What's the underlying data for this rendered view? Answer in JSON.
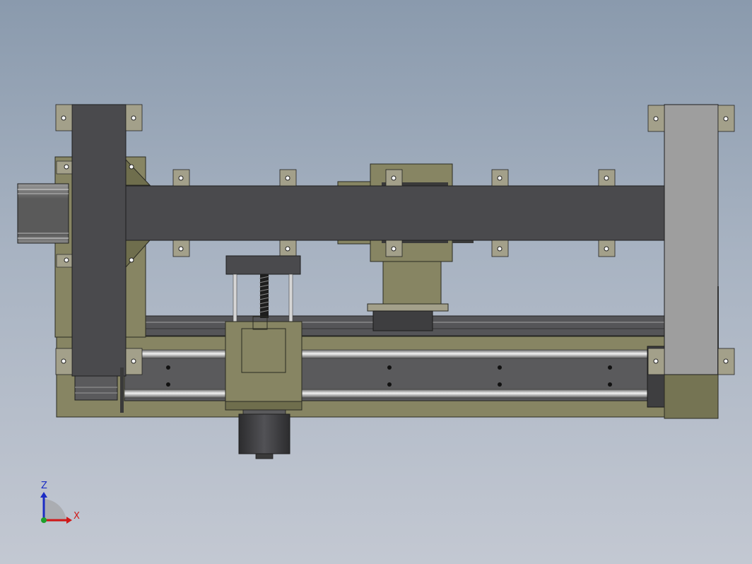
{
  "viewport": {
    "view": "front",
    "model": "linear-gantry-assembly"
  },
  "triad": {
    "z_label": "Z",
    "x_label": "X",
    "colors": {
      "z": "#1b2cc4",
      "x": "#d01818",
      "y": "#1ea02a"
    }
  },
  "palette": {
    "olive": "#878563",
    "olive_dark": "#6f6e4d",
    "beam": "#4a4a4d",
    "upright_right": "#9e9e9e",
    "pad": "#a3a08a",
    "motor": "#3c3c3e",
    "rod": "#cfcfcf"
  }
}
